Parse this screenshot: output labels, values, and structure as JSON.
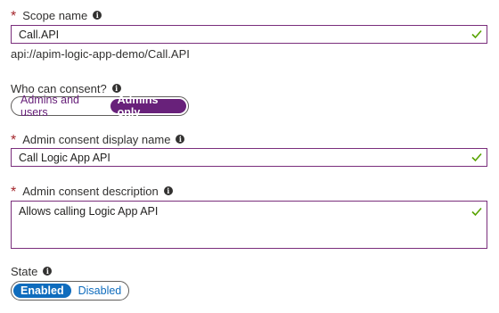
{
  "scope_name": {
    "label": "Scope name",
    "value": "Call.API",
    "uri": "api://apim-logic-app-demo/Call.API",
    "info_icon": "info-icon"
  },
  "who_can_consent": {
    "label": "Who can consent?",
    "options": [
      "Admins and users",
      "Admins only"
    ],
    "selected": "Admins only",
    "selected_color": "#68217a"
  },
  "admin_display_name": {
    "label": "Admin consent display name",
    "value": "Call Logic App API"
  },
  "admin_description": {
    "label": "Admin consent description",
    "value": "Allows calling Logic App API"
  },
  "state": {
    "label": "State",
    "options": [
      "Enabled",
      "Disabled"
    ],
    "selected": "Enabled",
    "selected_color": "#0f6cbd"
  },
  "colors": {
    "required_asterisk": "#a4262c",
    "field_border": "#7a2e7c",
    "valid_check": "#57a300"
  }
}
